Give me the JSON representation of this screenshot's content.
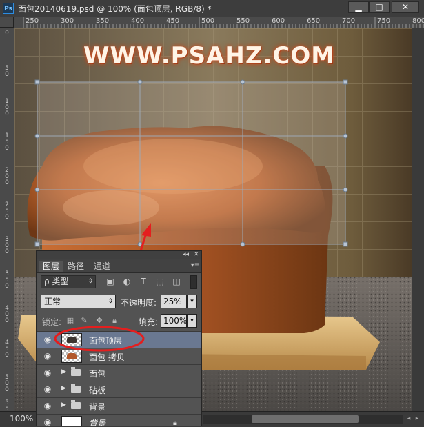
{
  "window": {
    "title": "面包20140619.psd @ 100% (面包顶层, RGB/8) *",
    "app_icon": "Ps",
    "minimize": "▁",
    "maximize": "□",
    "close": "✕"
  },
  "ruler": {
    "h_ticks": [
      "250",
      "300",
      "350",
      "400",
      "450",
      "500",
      "550",
      "600",
      "650",
      "700",
      "750",
      "800"
    ],
    "v_ticks": [
      "0",
      "50",
      "100",
      "150",
      "200",
      "250",
      "300",
      "350",
      "400",
      "450",
      "500",
      "550"
    ]
  },
  "canvas": {
    "watermark": "WWW.PSAHZ.COM"
  },
  "status": {
    "zoom": "100%"
  },
  "layers_panel": {
    "collapse_icon": "◂◂",
    "close_icon": "✕",
    "menu_icon": "▾≡",
    "tabs": [
      {
        "label": "图层",
        "active": true
      },
      {
        "label": "路径",
        "active": false
      },
      {
        "label": "通道",
        "active": false
      }
    ],
    "filter_kind": "ρ 类型",
    "blend_mode": "正常",
    "opacity_label": "不透明度:",
    "opacity_value": "25%",
    "lock_label": "锁定:",
    "fill_label": "填充:",
    "fill_value": "100%",
    "layers": [
      {
        "name": "面包顶层",
        "selected": true
      },
      {
        "name": "面包 拷贝",
        "selected": false
      },
      {
        "name": "面包",
        "selected": false
      },
      {
        "name": "砧板",
        "selected": false
      },
      {
        "name": "背景",
        "selected": false
      },
      {
        "name": "背景",
        "selected": false
      }
    ]
  },
  "annotation_color": "#e41e1e",
  "selection_color": "#6a7891"
}
